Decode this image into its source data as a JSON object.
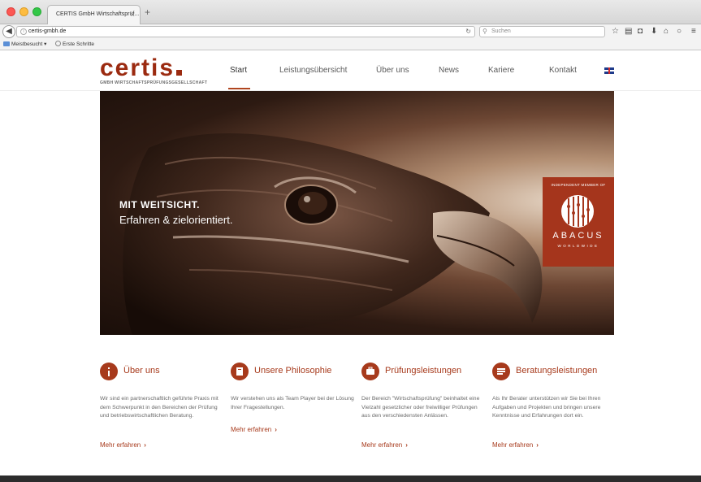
{
  "browser": {
    "tab_title": "CERTIS GmbH Wirtschaftsprüf...",
    "tab_close": "×",
    "new_tab": "+",
    "url": "certis-gmbh.de",
    "search_placeholder": "Suchen",
    "bookmarks": [
      "Meistbesucht ▾",
      "Erste Schritte"
    ]
  },
  "site": {
    "logo_word": "certis",
    "logo_sub": "GMBH WIRTSCHAFTSPRÜFUNGSGESELLSCHAFT",
    "menu": [
      "Start",
      "Leistungsübersicht",
      "Über uns",
      "News",
      "Kariere",
      "Kontakt"
    ],
    "active_menu": "Start",
    "accent_color": "#a73a1c"
  },
  "hero": {
    "title": "MIT WEITSICHT.",
    "subtitle": "Erfahren & zielorientiert.",
    "badge_top": "INDEPENDENT MEMBER OF",
    "badge_name": "ABACUS",
    "badge_sub": "WORLDWIDE"
  },
  "features": [
    {
      "title": "Über uns",
      "text": "Wir sind ein partnerschaftlich geführte Praxis mit dem Schwerpunkt in den Bereichen der Prüfung und betriebswirtschaftlichen Beratung.",
      "more": "Mehr erfahren",
      "icon": "info-icon"
    },
    {
      "title": "Unsere Philosophie",
      "text": "Wir verstehen uns als Team Player bei der Lösung Ihrer Fragestellungen.",
      "more": "Mehr erfahren",
      "icon": "book-icon"
    },
    {
      "title": "Prüfungsleistungen",
      "text": "Der Bereich \"Wirtschaftsprüfung\" beinhaltet eine Vielzahl gesetzlicher oder freiwilliger Prüfungen aus den verschiedensten Anlässen.",
      "more": "Mehr erfahren",
      "icon": "briefcase-icon"
    },
    {
      "title": "Beratungsleistungen",
      "text": "Als Ihr Berater unterstützen wir Sie bei Ihren Aufgaben und Projekten und bringen unsere Kenntnisse und Erfahrungen dort ein.",
      "more": "Mehr erfahren",
      "icon": "document-icon"
    }
  ]
}
